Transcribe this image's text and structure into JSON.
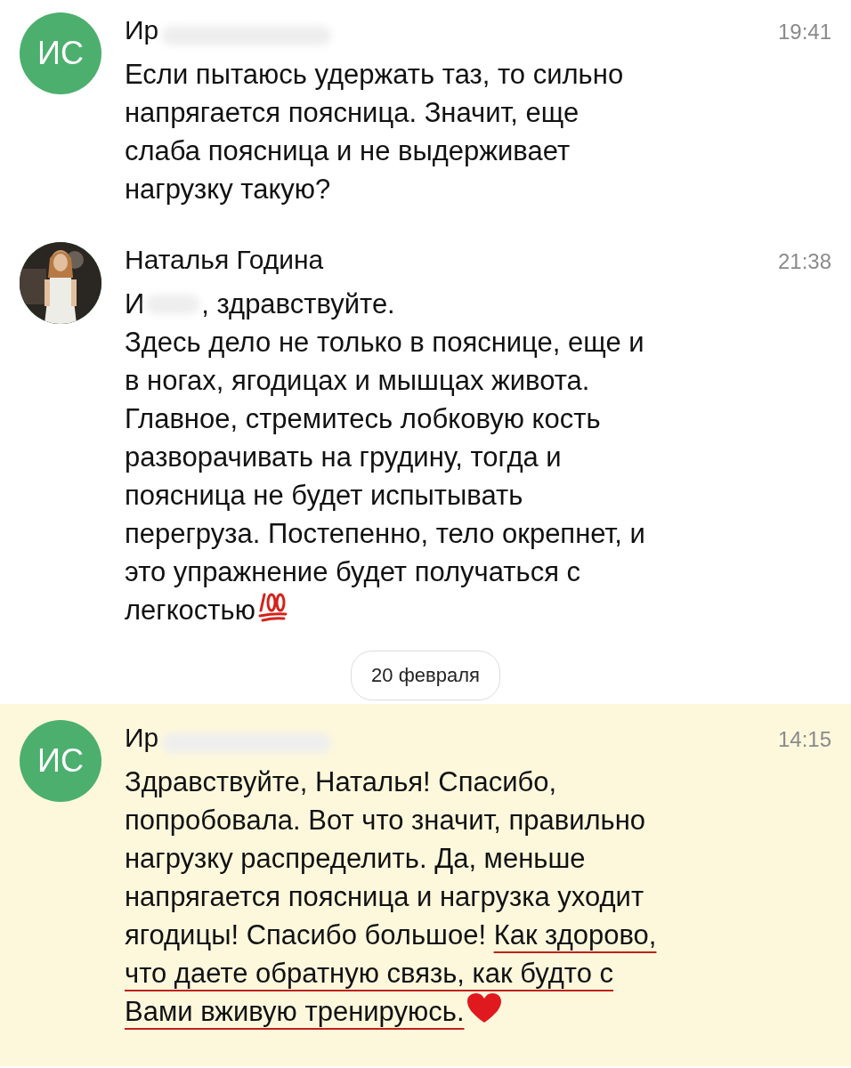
{
  "messages": [
    {
      "avatar": {
        "kind": "initials",
        "initials": "ИС"
      },
      "name": "Ир",
      "time": "19:41",
      "highlighted": false,
      "text": "Если пытаюсь удержать таз, то сильно\nнапрягается поясница. Значит, еще\nслаба поясница и не выдерживает\nнагрузку такую?"
    },
    {
      "name": "Наталья Година",
      "time": "21:38",
      "highlighted": false,
      "greeting_start": "И",
      "greeting_end": ", здравствуйте.",
      "text": "Здесь дело не только в пояснице, еще и\nв ногах, ягодицах и мышцах живота.\nГлавное, стремитесь лобковую кость\nразворачивать на грудину, тогда и\nпоясница не будет испытывать\nперегруза. Постепенно, тело окрепнет, и\nэто упражнение будет получаться с\nлегкостью",
      "end_icon": {
        "kind": "hundred"
      }
    },
    {
      "kind": "date",
      "label": "20 февраля"
    },
    {
      "avatar": {
        "kind": "initials",
        "initials": "ИС"
      },
      "name": "Ир",
      "time": "14:15",
      "highlighted": true,
      "text": "Здравствуйте, Наталья! Спасибо,\nпопробовала. Вот что значит, правильно\nнагрузку распределить. Да, меньше\nнапрягается поясница и нагрузка уходит\nягодицы! Спасибо большое! ",
      "underlined": "Как здорово,\nчто даете обратную связь, как будто с\nВами вживую тренируюсь.",
      "end_icon": {
        "kind": "heart"
      }
    }
  ]
}
